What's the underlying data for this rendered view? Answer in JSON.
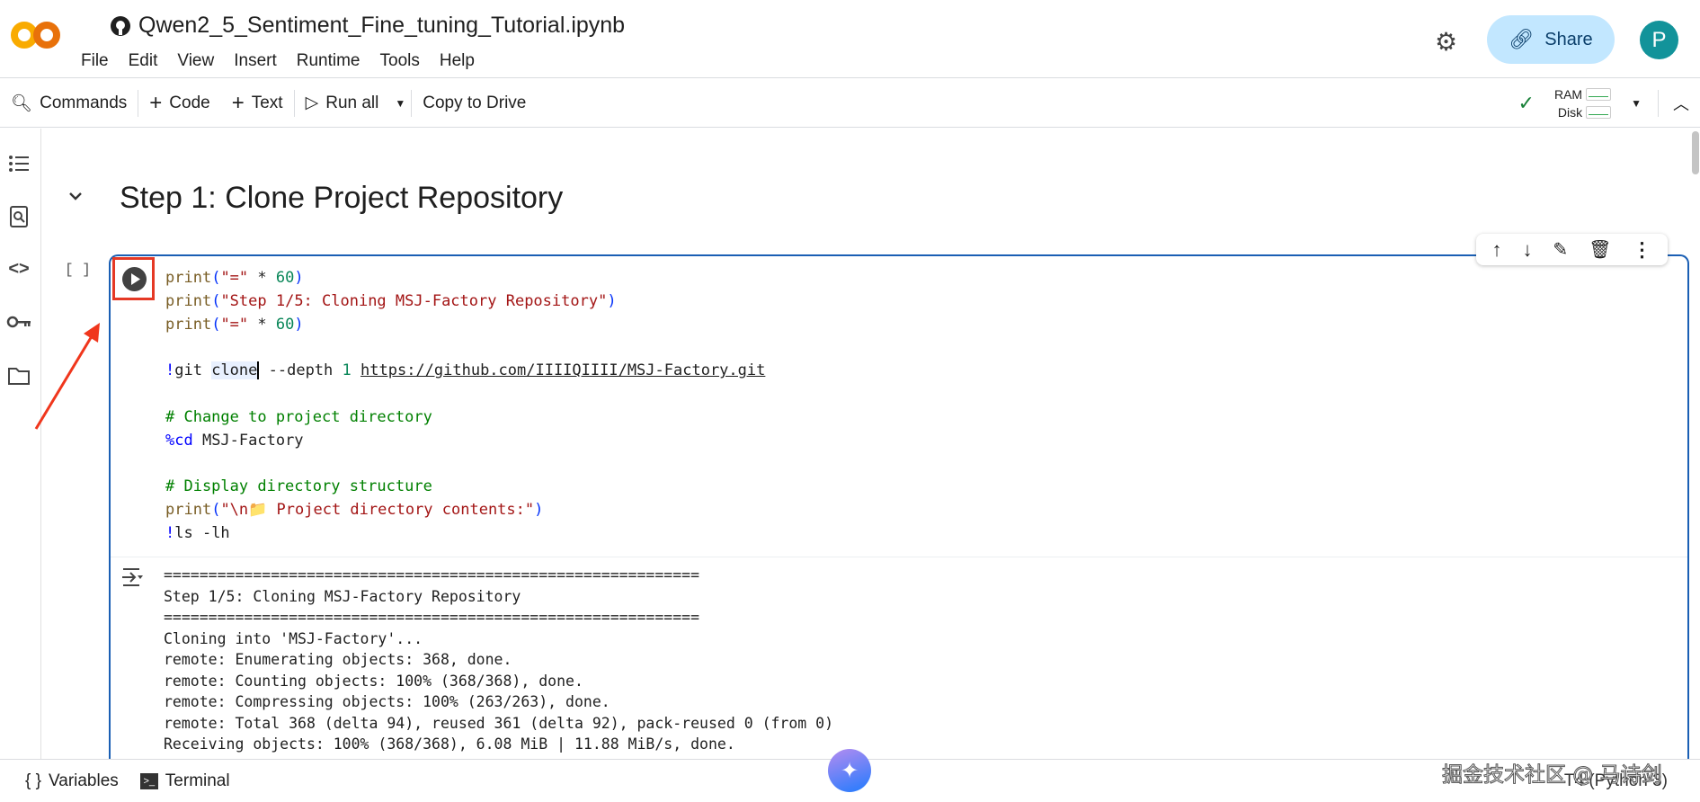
{
  "header": {
    "title": "Qwen2_5_Sentiment_Fine_tuning_Tutorial.ipynb",
    "logo_text": "CO",
    "menu": [
      "File",
      "Edit",
      "View",
      "Insert",
      "Runtime",
      "Tools",
      "Help"
    ],
    "share_label": "Share",
    "avatar_letter": "P"
  },
  "toolbar": {
    "commands": "Commands",
    "code": "Code",
    "text": "Text",
    "run_all": "Run all",
    "copy_to_drive": "Copy to Drive",
    "ram_label": "RAM",
    "disk_label": "Disk"
  },
  "section": {
    "heading": "Step 1: Clone Project Repository"
  },
  "cell": {
    "exec_count": "[ ]"
  },
  "output": {
    "lines": [
      "============================================================",
      "Step 1/5: Cloning MSJ-Factory Repository",
      "============================================================",
      "Cloning into 'MSJ-Factory'...",
      "remote: Enumerating objects: 368, done.",
      "remote: Counting objects: 100% (368/368), done.",
      "remote: Compressing objects: 100% (263/263), done.",
      "remote: Total 368 (delta 94), reused 361 (delta 92), pack-reused 0 (from 0)",
      "Receiving objects: 100% (368/368), 6.08 MiB | 11.88 MiB/s, done."
    ]
  },
  "code": {
    "l1a": "print",
    "l1b": "(",
    "l1c": "\"=\"",
    "l1d": " * ",
    "l1e": "60",
    "l1f": ")",
    "l2c": "\"Step 1/5: Cloning MSJ-Factory Repository\"",
    "git_bang": "!",
    "git_cmd": "git ",
    "git_clone": "clone",
    "git_depth": " --depth ",
    "git_1": "1",
    "git_url": "https://github.com/IIIIQIIII/MSJ-Factory.git",
    "c1": "# Change to project directory",
    "cd_magic": "%cd",
    "cd_arg": " MSJ-Factory",
    "c2": "# Display directory structure",
    "p3": "\"\\n📁 Project directory contents:\"",
    "ls_bang": "!",
    "ls_cmd": "ls -lh"
  },
  "bottom": {
    "variables": "Variables",
    "terminal": "Terminal",
    "runtime": "T4 (Python 3)",
    "watermark": "掘金技术社区 @ 马诗剑"
  },
  "colors": {
    "accent": "#1a5fb4",
    "highlight": "#e53925",
    "share_bg": "#c2e7ff"
  }
}
